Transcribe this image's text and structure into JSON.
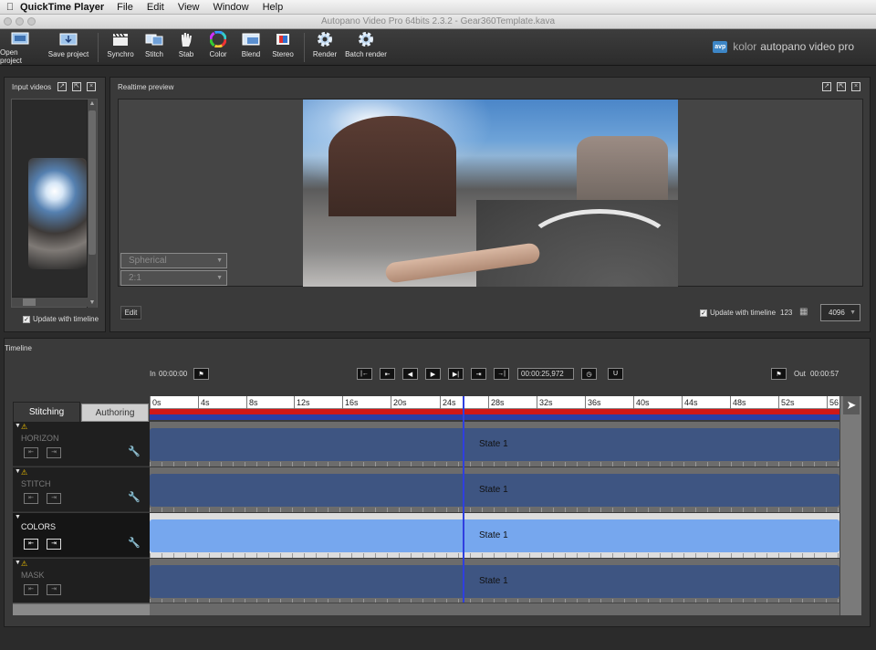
{
  "menubar": {
    "app_name": "QuickTime Player",
    "items": [
      "File",
      "Edit",
      "View",
      "Window",
      "Help"
    ]
  },
  "window": {
    "title": "Autopano Video Pro 64bits 2.3.2 - Gear360Template.kava"
  },
  "toolbar": {
    "buttons": [
      {
        "label": "Open project",
        "icon": "open-project-icon"
      },
      {
        "label": "Save project",
        "icon": "save-project-icon"
      },
      {
        "label": "Synchro",
        "icon": "clapper-icon"
      },
      {
        "label": "Stitch",
        "icon": "stitch-icon"
      },
      {
        "label": "Stab",
        "icon": "hand-icon"
      },
      {
        "label": "Color",
        "icon": "color-wheel-icon"
      },
      {
        "label": "Blend",
        "icon": "blend-icon"
      },
      {
        "label": "Stereo",
        "icon": "stereo-icon"
      },
      {
        "label": "Render",
        "icon": "gear-icon"
      },
      {
        "label": "Batch render",
        "icon": "gear-icon"
      }
    ],
    "brand_logo": "avp",
    "brand_prefix": "kolor",
    "brand_name": "autopano video pro"
  },
  "input_panel": {
    "title": "Input videos",
    "update_label": "Update with timeline",
    "update_checked": true
  },
  "preview_panel": {
    "title": "Realtime preview",
    "projection": "Spherical",
    "ratio": "2:1",
    "edit_label": "Edit",
    "update_label": "Update with timeline",
    "update_checked": true,
    "counter": "123",
    "resolution": "4096"
  },
  "timeline": {
    "title": "Timeline",
    "in_label": "In",
    "in_time": "00:00:00",
    "out_label": "Out",
    "out_time": "00:00:57",
    "current_time": "00:00:25,972",
    "tabs": [
      "Stitching",
      "Authoring"
    ],
    "active_tab": "Stitching",
    "ruler": [
      "0s",
      "4s",
      "8s",
      "12s",
      "16s",
      "20s",
      "24s",
      "28s",
      "32s",
      "36s",
      "40s",
      "44s",
      "48s",
      "52s",
      "56"
    ],
    "tracks": [
      {
        "name": "HORIZON",
        "warning": true,
        "state": "State 1",
        "active": false
      },
      {
        "name": "STITCH",
        "warning": true,
        "state": "State 1",
        "active": false
      },
      {
        "name": "COLORS",
        "warning": false,
        "state": "State 1",
        "active": true
      },
      {
        "name": "MASK",
        "warning": true,
        "state": "State 1",
        "active": false
      }
    ]
  },
  "colors": {
    "track_bar": "#3e5582",
    "track_bar_active": "#76a7ee",
    "playhead": "#2f3fe0",
    "red_range": "#d01818",
    "blue_range": "#2a3fa8",
    "warning": "#f0c000"
  }
}
